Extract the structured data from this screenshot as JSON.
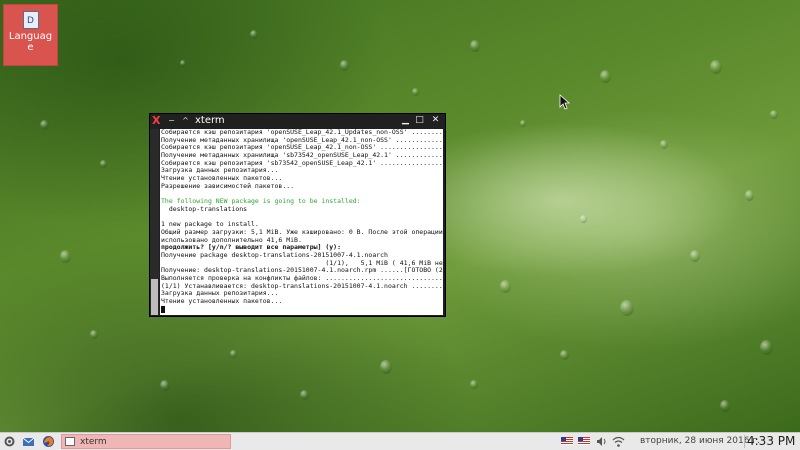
{
  "desktop": {
    "icons": [
      {
        "label": "Language",
        "glyph": "D"
      }
    ]
  },
  "window": {
    "title": "xterm",
    "logo": "X",
    "menu_glyph": "−",
    "shade_glyph": "^",
    "min_glyph": "▁",
    "max_glyph": "□",
    "close_glyph": "✕"
  },
  "terminal": {
    "lines": [
      {
        "text": "Собирается кэш репозитария 'openSUSE_Leap_42.1_Updates_non-OSS' .........[ГОТОВО]",
        "style": ""
      },
      {
        "text": "Получение метаданных хранилища 'openSUSE_Leap_42.1_non-OSS' ..............[ГОТОВО]",
        "style": ""
      },
      {
        "text": "Собирается кэш репозитария 'openSUSE_Leap_42.1_non-OSS' ..................[ГОТОВО]",
        "style": ""
      },
      {
        "text": "Получение метаданных хранилища 'sb73542_openSUSE_Leap_42.1' ..............[ГОТОВО]",
        "style": ""
      },
      {
        "text": "Собирается кэш репозитария 'sb73542_openSUSE_Leap_42.1' ..................[ГОТОВО]",
        "style": ""
      },
      {
        "text": "Загрузка данных репозитария...",
        "style": ""
      },
      {
        "text": "Чтение установленных пакетов...",
        "style": ""
      },
      {
        "text": "Разрешение зависимостей пакетов...",
        "style": ""
      },
      {
        "text": "",
        "style": ""
      },
      {
        "text": "The following NEW package is going to be installed:",
        "style": "green"
      },
      {
        "text": "  desktop-translations",
        "style": ""
      },
      {
        "text": "",
        "style": ""
      },
      {
        "text": "1 new package to install.",
        "style": ""
      },
      {
        "text": "Общий размер загрузки: 5,1 MiB. Уже кэшировано: 0 B. После этой операции будет",
        "style": ""
      },
      {
        "text": "использовано дополнительно 41,6 MiB.",
        "style": ""
      },
      {
        "text": "продолжить? [y/n/? выводит все параметры] (y):",
        "style": "bold"
      },
      {
        "text": "Получение package desktop-translations-20151007-4.1.noarch",
        "style": ""
      },
      {
        "text": "                                          (1/1),   5,1 MiB ( 41,6 MiB нераспаковано)",
        "style": ""
      },
      {
        "text": "Получение: desktop-translations-20151007-4.1.noarch.rpm ......[ГОТОВО (2,2 MiB/s)]",
        "style": ""
      },
      {
        "text": "Выполняется проверка на конфликты файлов: ..............................[ГОТОВО]",
        "style": ""
      },
      {
        "text": "(1/1) Устанавливается: desktop-translations-20151007-4.1.noarch .........[ГОТОВО]",
        "style": ""
      },
      {
        "text": "Загрузка данных репозитария...",
        "style": ""
      },
      {
        "text": "Чтение установленных пакетов...",
        "style": ""
      }
    ]
  },
  "taskbar": {
    "task_label": "xterm",
    "date": "вторник, 28 июня 2016 г.",
    "time": "4:33 PM"
  },
  "colors": {
    "accent_task": "#f0b6b6",
    "icon_bg": "#d9534f",
    "term_green": "#2fa62f"
  }
}
